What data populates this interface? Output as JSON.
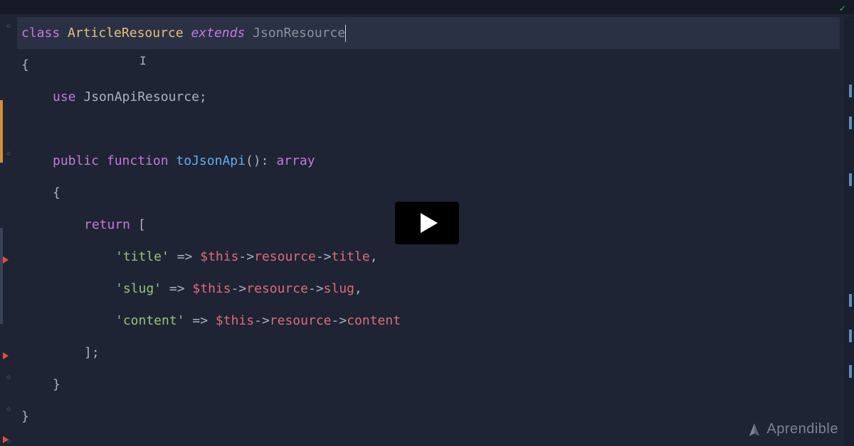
{
  "status": {
    "checkmark": "✓"
  },
  "code": {
    "line1": {
      "class_kw": "class",
      "class_name": "ArticleResource",
      "extends_kw": "extends",
      "parent_name": "JsonResource"
    },
    "line2": {
      "brace": "{"
    },
    "line3": {
      "use_kw": "use",
      "trait": "JsonApiResource",
      "semi": ";"
    },
    "line5": {
      "public_kw": "public",
      "function_kw": "function",
      "func_name": "toJsonApi",
      "parens": "()",
      "colon": ":",
      "return_type": "array"
    },
    "line6": {
      "brace": "{"
    },
    "line7": {
      "return_kw": "return",
      "bracket": "["
    },
    "line8": {
      "key": "'title'",
      "arrow": "=>",
      "dollar_this": "$this",
      "obj_arrow1": "->",
      "prop1": "resource",
      "obj_arrow2": "->",
      "prop2": "title",
      "comma": ","
    },
    "line9": {
      "key": "'slug'",
      "arrow": "=>",
      "dollar_this": "$this",
      "obj_arrow1": "->",
      "prop1": "resource",
      "obj_arrow2": "->",
      "prop2": "slug",
      "comma": ","
    },
    "line10": {
      "key": "'content'",
      "arrow": "=>",
      "dollar_this": "$this",
      "obj_arrow1": "->",
      "prop1": "resource",
      "obj_arrow2": "->",
      "prop2": "content"
    },
    "line11": {
      "bracket": "]",
      "semi": ";"
    },
    "line12": {
      "brace": "}"
    },
    "line13": {
      "brace": "}"
    }
  },
  "watermark": {
    "text": "Aprendible"
  }
}
